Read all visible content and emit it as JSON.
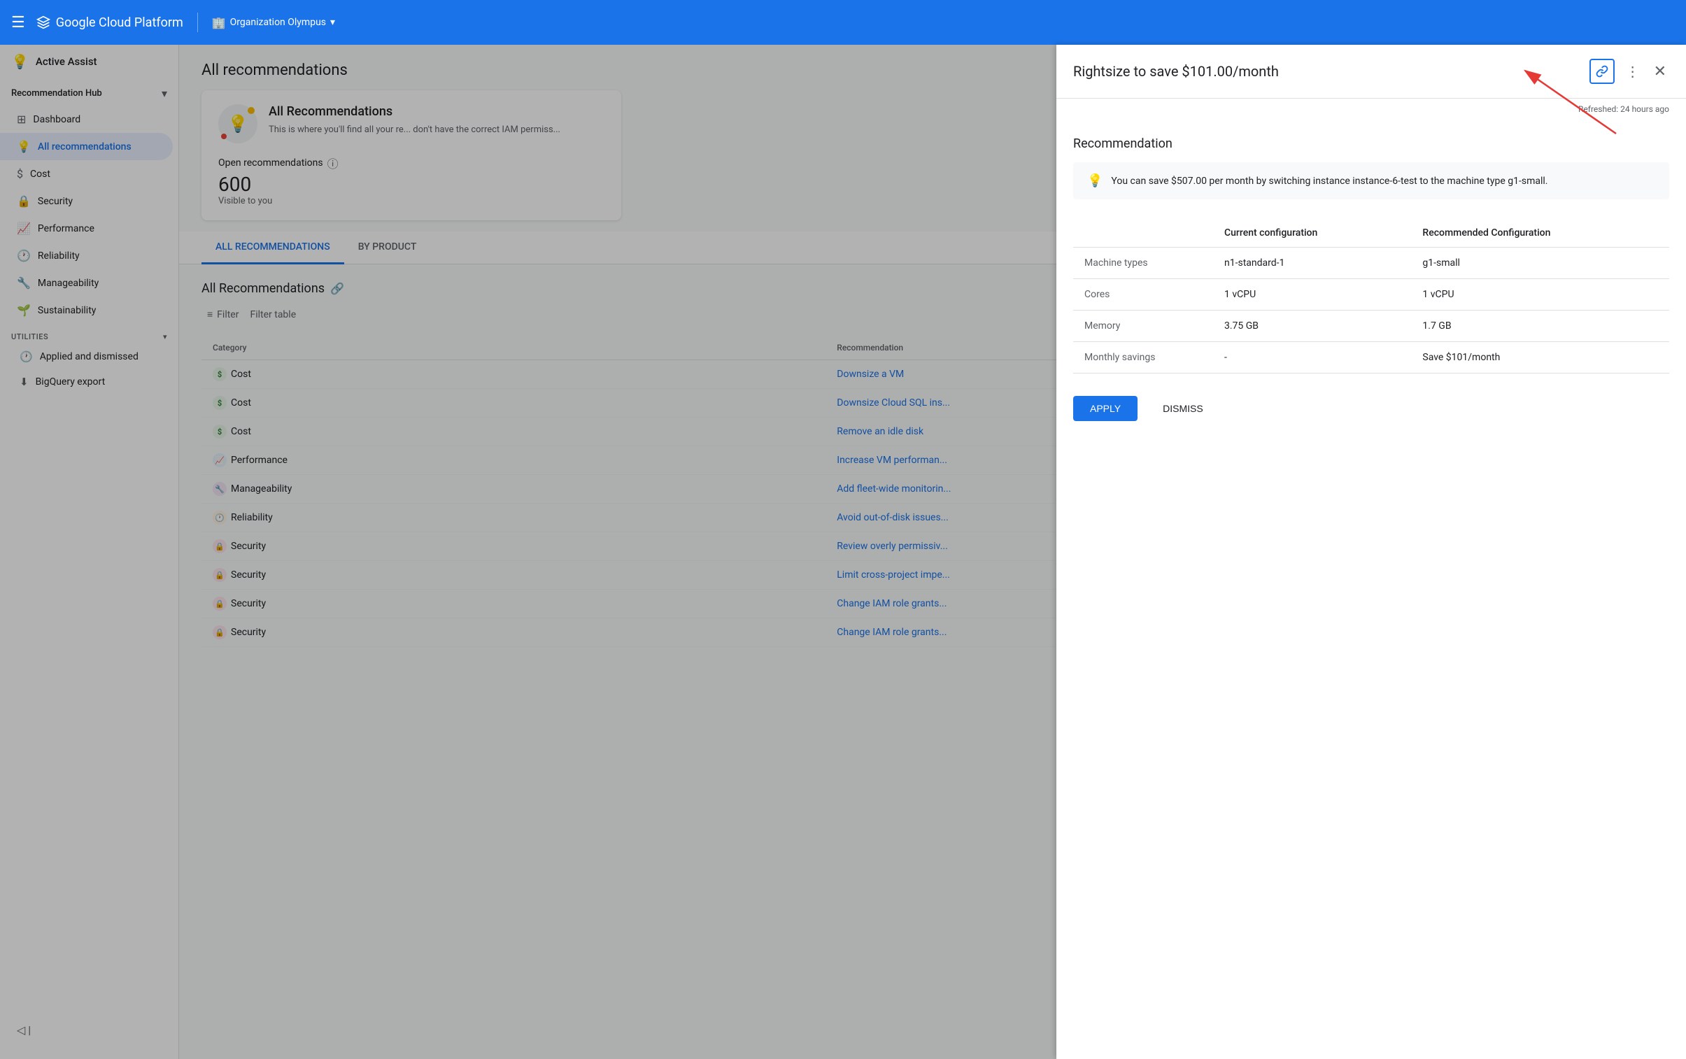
{
  "app": {
    "name": "Google Cloud Platform",
    "org": "Organization Olympus",
    "org_icon": "🏢"
  },
  "sidebar": {
    "active_assist_label": "Active Assist",
    "recommendation_hub_label": "Recommendation Hub",
    "items": [
      {
        "id": "dashboard",
        "label": "Dashboard",
        "icon": "⊞"
      },
      {
        "id": "all-recommendations",
        "label": "All recommendations",
        "icon": "💡",
        "active": true
      },
      {
        "id": "cost",
        "label": "Cost",
        "icon": "$"
      },
      {
        "id": "security",
        "label": "Security",
        "icon": "🔒"
      },
      {
        "id": "performance",
        "label": "Performance",
        "icon": "📈"
      },
      {
        "id": "reliability",
        "label": "Reliability",
        "icon": "🕐"
      },
      {
        "id": "manageability",
        "label": "Manageability",
        "icon": "🔧"
      },
      {
        "id": "sustainability",
        "label": "Sustainability",
        "icon": "🌱"
      }
    ],
    "utilities_label": "Utilities",
    "utility_items": [
      {
        "id": "applied-dismissed",
        "label": "Applied and dismissed",
        "icon": "🕐"
      },
      {
        "id": "bigquery-export",
        "label": "BigQuery export",
        "icon": "⬇"
      }
    ],
    "collapse_label": "◁ |"
  },
  "main": {
    "title": "All recommendations",
    "card": {
      "heading": "All Recommendations",
      "description": "This is where you'll find all your re... don't have the correct IAM permiss...",
      "open_recs_label": "Open recommendations",
      "open_recs_count": "600",
      "visible_label": "Visible to you"
    },
    "tabs": [
      {
        "id": "all-recs",
        "label": "ALL RECOMMENDATIONS",
        "active": true
      },
      {
        "id": "by-product",
        "label": "BY PRODUCT",
        "active": false
      }
    ],
    "table": {
      "section_title": "All Recommendations",
      "filter_label": "Filter",
      "filter_table_label": "Filter table",
      "columns": [
        "Category",
        "Recommendation"
      ],
      "rows": [
        {
          "category": "Cost",
          "badge_type": "cost",
          "recommendation": "Downsize a VM"
        },
        {
          "category": "Cost",
          "badge_type": "cost",
          "recommendation": "Downsize Cloud SQL ins..."
        },
        {
          "category": "Cost",
          "badge_type": "cost",
          "recommendation": "Remove an idle disk"
        },
        {
          "category": "Performance",
          "badge_type": "perf",
          "recommendation": "Increase VM performan..."
        },
        {
          "category": "Manageability",
          "badge_type": "manage",
          "recommendation": "Add fleet-wide monitorin..."
        },
        {
          "category": "Reliability",
          "badge_type": "reliability",
          "recommendation": "Avoid out-of-disk issues..."
        },
        {
          "category": "Security",
          "badge_type": "security",
          "recommendation": "Review overly permissiv..."
        },
        {
          "category": "Security",
          "badge_type": "security",
          "recommendation": "Limit cross-project impe..."
        },
        {
          "category": "Security",
          "badge_type": "security",
          "recommendation": "Change IAM role grants..."
        },
        {
          "category": "Security",
          "badge_type": "security",
          "recommendation": "Change IAM role grants..."
        }
      ]
    }
  },
  "detail_panel": {
    "title": "Rightsize to save $101.00/month",
    "refreshed_label": "Refreshed: 24 hours ago",
    "section_title": "Recommendation",
    "info_text": "You can save $507.00 per month by switching instance instance-6-test to the machine type g1-small.",
    "table": {
      "headers": [
        "",
        "Current configuration",
        "Recommended Configuration"
      ],
      "rows": [
        {
          "label": "Machine types",
          "current": "n1-standard-1",
          "recommended": "g1-small"
        },
        {
          "label": "Cores",
          "current": "1 vCPU",
          "recommended": "1 vCPU"
        },
        {
          "label": "Memory",
          "current": "3.75 GB",
          "recommended": "1.7 GB"
        },
        {
          "label": "Monthly savings",
          "current": "-",
          "recommended": "Save $101/month"
        }
      ]
    },
    "apply_label": "APPLY",
    "dismiss_label": "DISMISS",
    "arrow_text": "Refreshed: 24 hours ago"
  }
}
